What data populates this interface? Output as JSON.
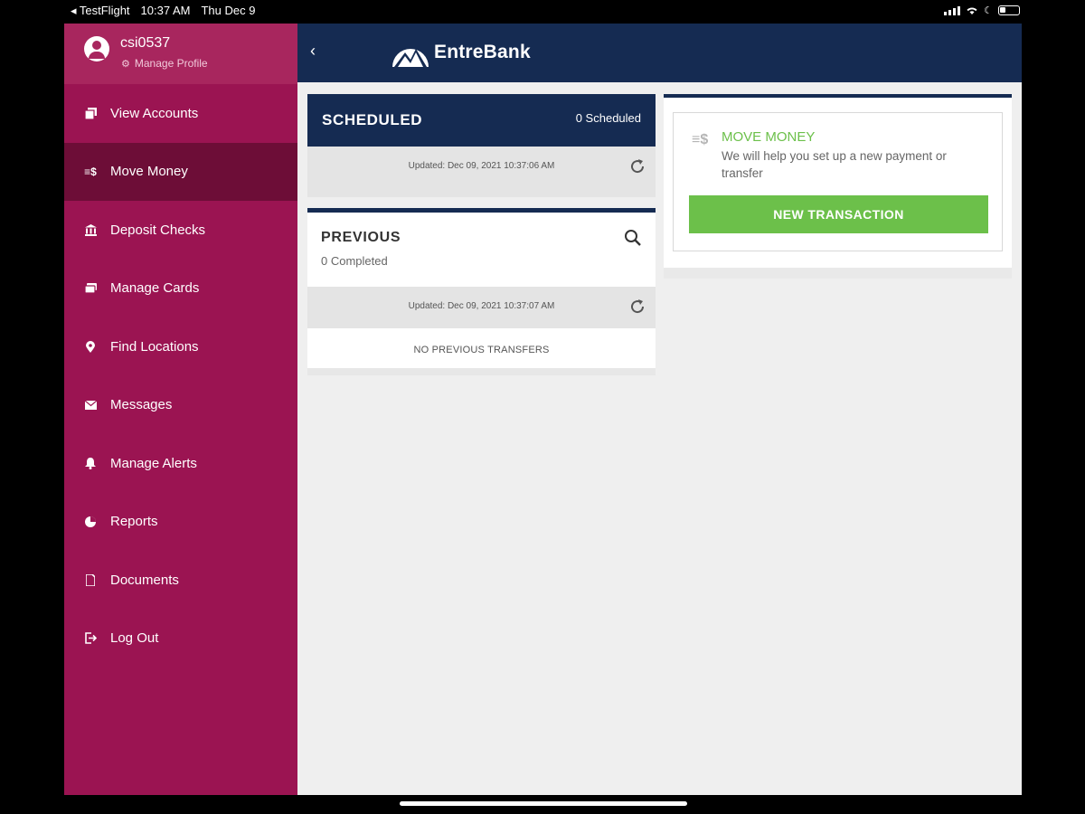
{
  "status_bar": {
    "carrier": "◂ TestFlight",
    "time": "10:37 AM",
    "date": "Thu Dec 9"
  },
  "profile": {
    "username": "csi0537",
    "manage_label": "Manage Profile"
  },
  "sidebar": {
    "items": [
      {
        "label": "View Accounts",
        "icon": "accounts-icon"
      },
      {
        "label": "Move Money",
        "icon": "transfer-icon",
        "active": true
      },
      {
        "label": "Deposit Checks",
        "icon": "bank-icon"
      },
      {
        "label": "Manage Cards",
        "icon": "card-icon"
      },
      {
        "label": "Find Locations",
        "icon": "location-pin-icon"
      },
      {
        "label": "Messages",
        "icon": "envelope-icon"
      },
      {
        "label": "Manage Alerts",
        "icon": "bell-icon"
      },
      {
        "label": "Reports",
        "icon": "pie-chart-icon"
      },
      {
        "label": "Documents",
        "icon": "document-icon"
      },
      {
        "label": "Log Out",
        "icon": "logout-icon"
      }
    ]
  },
  "header": {
    "brand": "EntreBank"
  },
  "scheduled": {
    "title": "SCHEDULED",
    "count": "0 Scheduled",
    "updated": "Updated: Dec 09, 2021 10:37:06 AM"
  },
  "previous": {
    "title": "PREVIOUS",
    "completed": "0 Completed",
    "updated": "Updated: Dec 09, 2021 10:37:07 AM",
    "empty": "NO PREVIOUS TRANSFERS"
  },
  "move_money": {
    "title": "MOVE MONEY",
    "description": "We will help you set up a new payment or transfer",
    "button": "NEW TRANSACTION"
  },
  "colors": {
    "sidebar": "#9b1452",
    "sidebar_active": "#6d0d37",
    "header": "#152b52",
    "accent_green": "#6cc04a"
  }
}
